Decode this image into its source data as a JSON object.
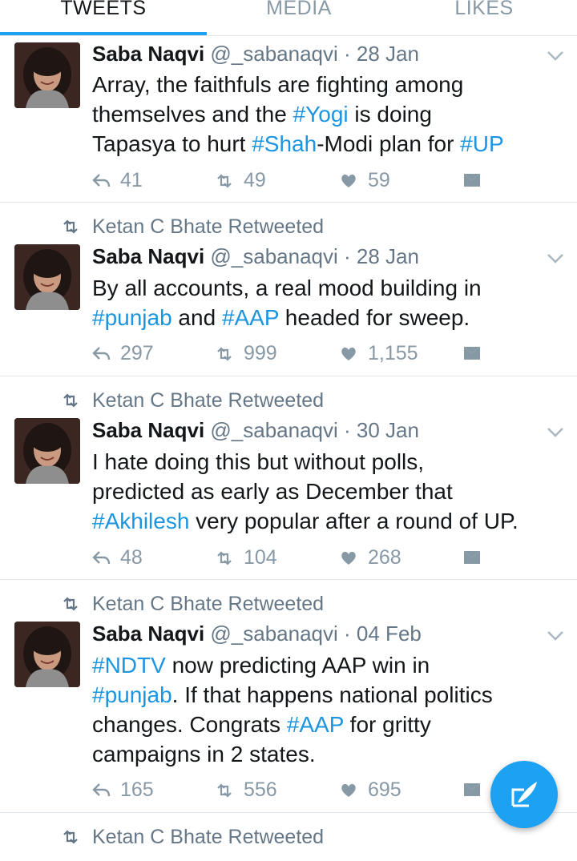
{
  "tabs": [
    "TWEETS",
    "MEDIA",
    "LIKES"
  ],
  "tweets": [
    {
      "retweeted_by": "",
      "name": "Saba Naqvi",
      "handle": "@_sabanaqvi",
      "date": "· 28 Jan",
      "lines": [
        [
          {
            "t": "Array, the faithfuls are fighting among",
            "h": false
          }
        ],
        [
          {
            "t": "themselves and the ",
            "h": false
          },
          {
            "t": "#Yogi",
            "h": true
          },
          {
            "t": " is doing",
            "h": false
          }
        ],
        [
          {
            "t": "Tapasya to hurt ",
            "h": false
          },
          {
            "t": "#Shah",
            "h": true
          },
          {
            "t": "-Modi plan for ",
            "h": false
          },
          {
            "t": "#UP",
            "h": true
          }
        ]
      ],
      "replies": "41",
      "retweets": "49",
      "likes": "59"
    },
    {
      "retweeted_by": "Ketan C Bhate Retweeted",
      "name": "Saba Naqvi",
      "handle": "@_sabanaqvi",
      "date": "· 28 Jan",
      "lines": [
        [
          {
            "t": "By all accounts, a real mood building in",
            "h": false
          }
        ],
        [
          {
            "t": "#punjab",
            "h": true
          },
          {
            "t": " and ",
            "h": false
          },
          {
            "t": "#AAP",
            "h": true
          },
          {
            "t": " headed for sweep.",
            "h": false
          }
        ]
      ],
      "replies": "297",
      "retweets": "999",
      "likes": "1,155"
    },
    {
      "retweeted_by": "Ketan C Bhate Retweeted",
      "name": "Saba Naqvi",
      "handle": "@_sabanaqvi",
      "date": "· 30 Jan",
      "lines": [
        [
          {
            "t": "I hate doing this but without polls,",
            "h": false
          }
        ],
        [
          {
            "t": "predicted as early as December that",
            "h": false
          }
        ],
        [
          {
            "t": "#Akhilesh",
            "h": true
          },
          {
            "t": " very popular after a round of UP.",
            "h": false
          }
        ]
      ],
      "replies": "48",
      "retweets": "104",
      "likes": "268"
    },
    {
      "retweeted_by": "Ketan C Bhate Retweeted",
      "name": "Saba Naqvi",
      "handle": "@_sabanaqvi",
      "date": "· 04 Feb",
      "lines": [
        [
          {
            "t": "#NDTV",
            "h": true
          },
          {
            "t": " now predicting AAP win in",
            "h": false
          }
        ],
        [
          {
            "t": "#punjab",
            "h": true
          },
          {
            "t": ". If that happens national politics",
            "h": false
          }
        ],
        [
          {
            "t": "changes. Congrats ",
            "h": false
          },
          {
            "t": "#AAP",
            "h": true
          },
          {
            "t": " for gritty",
            "h": false
          }
        ],
        [
          {
            "t": "campaigns in 2 states.",
            "h": false
          }
        ]
      ],
      "replies": "165",
      "retweets": "556",
      "likes": "695"
    },
    {
      "retweeted_by": "Ketan C Bhate Retweeted"
    }
  ],
  "colors": {
    "accent": "#1da1f2",
    "hashtag": "#1b95e0",
    "muted": "#8899a6"
  },
  "icons": [
    "reply-icon",
    "retweet-icon",
    "like-icon",
    "direct-message-icon",
    "chevron-down-icon",
    "compose-tweet-icon"
  ]
}
